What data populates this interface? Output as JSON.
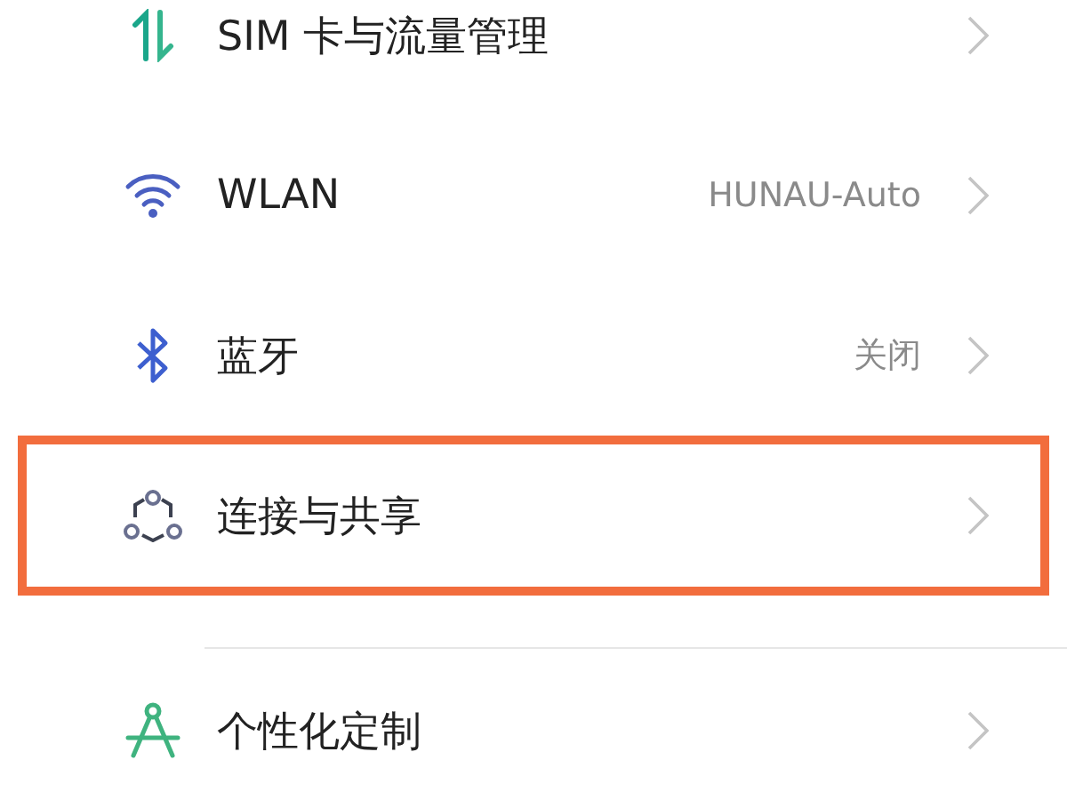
{
  "sections": [
    {
      "items": [
        {
          "label": "SIM 卡与流量管理",
          "highlighted": false
        },
        {
          "label": "WLAN",
          "value": "HUNAU-Auto",
          "highlighted": false
        },
        {
          "label": "蓝牙",
          "value": "关闭",
          "highlighted": false
        },
        {
          "label": "连接与共享",
          "highlighted": true
        }
      ]
    },
    {
      "items": [
        {
          "label": "个性化定制",
          "highlighted": false
        }
      ]
    }
  ]
}
